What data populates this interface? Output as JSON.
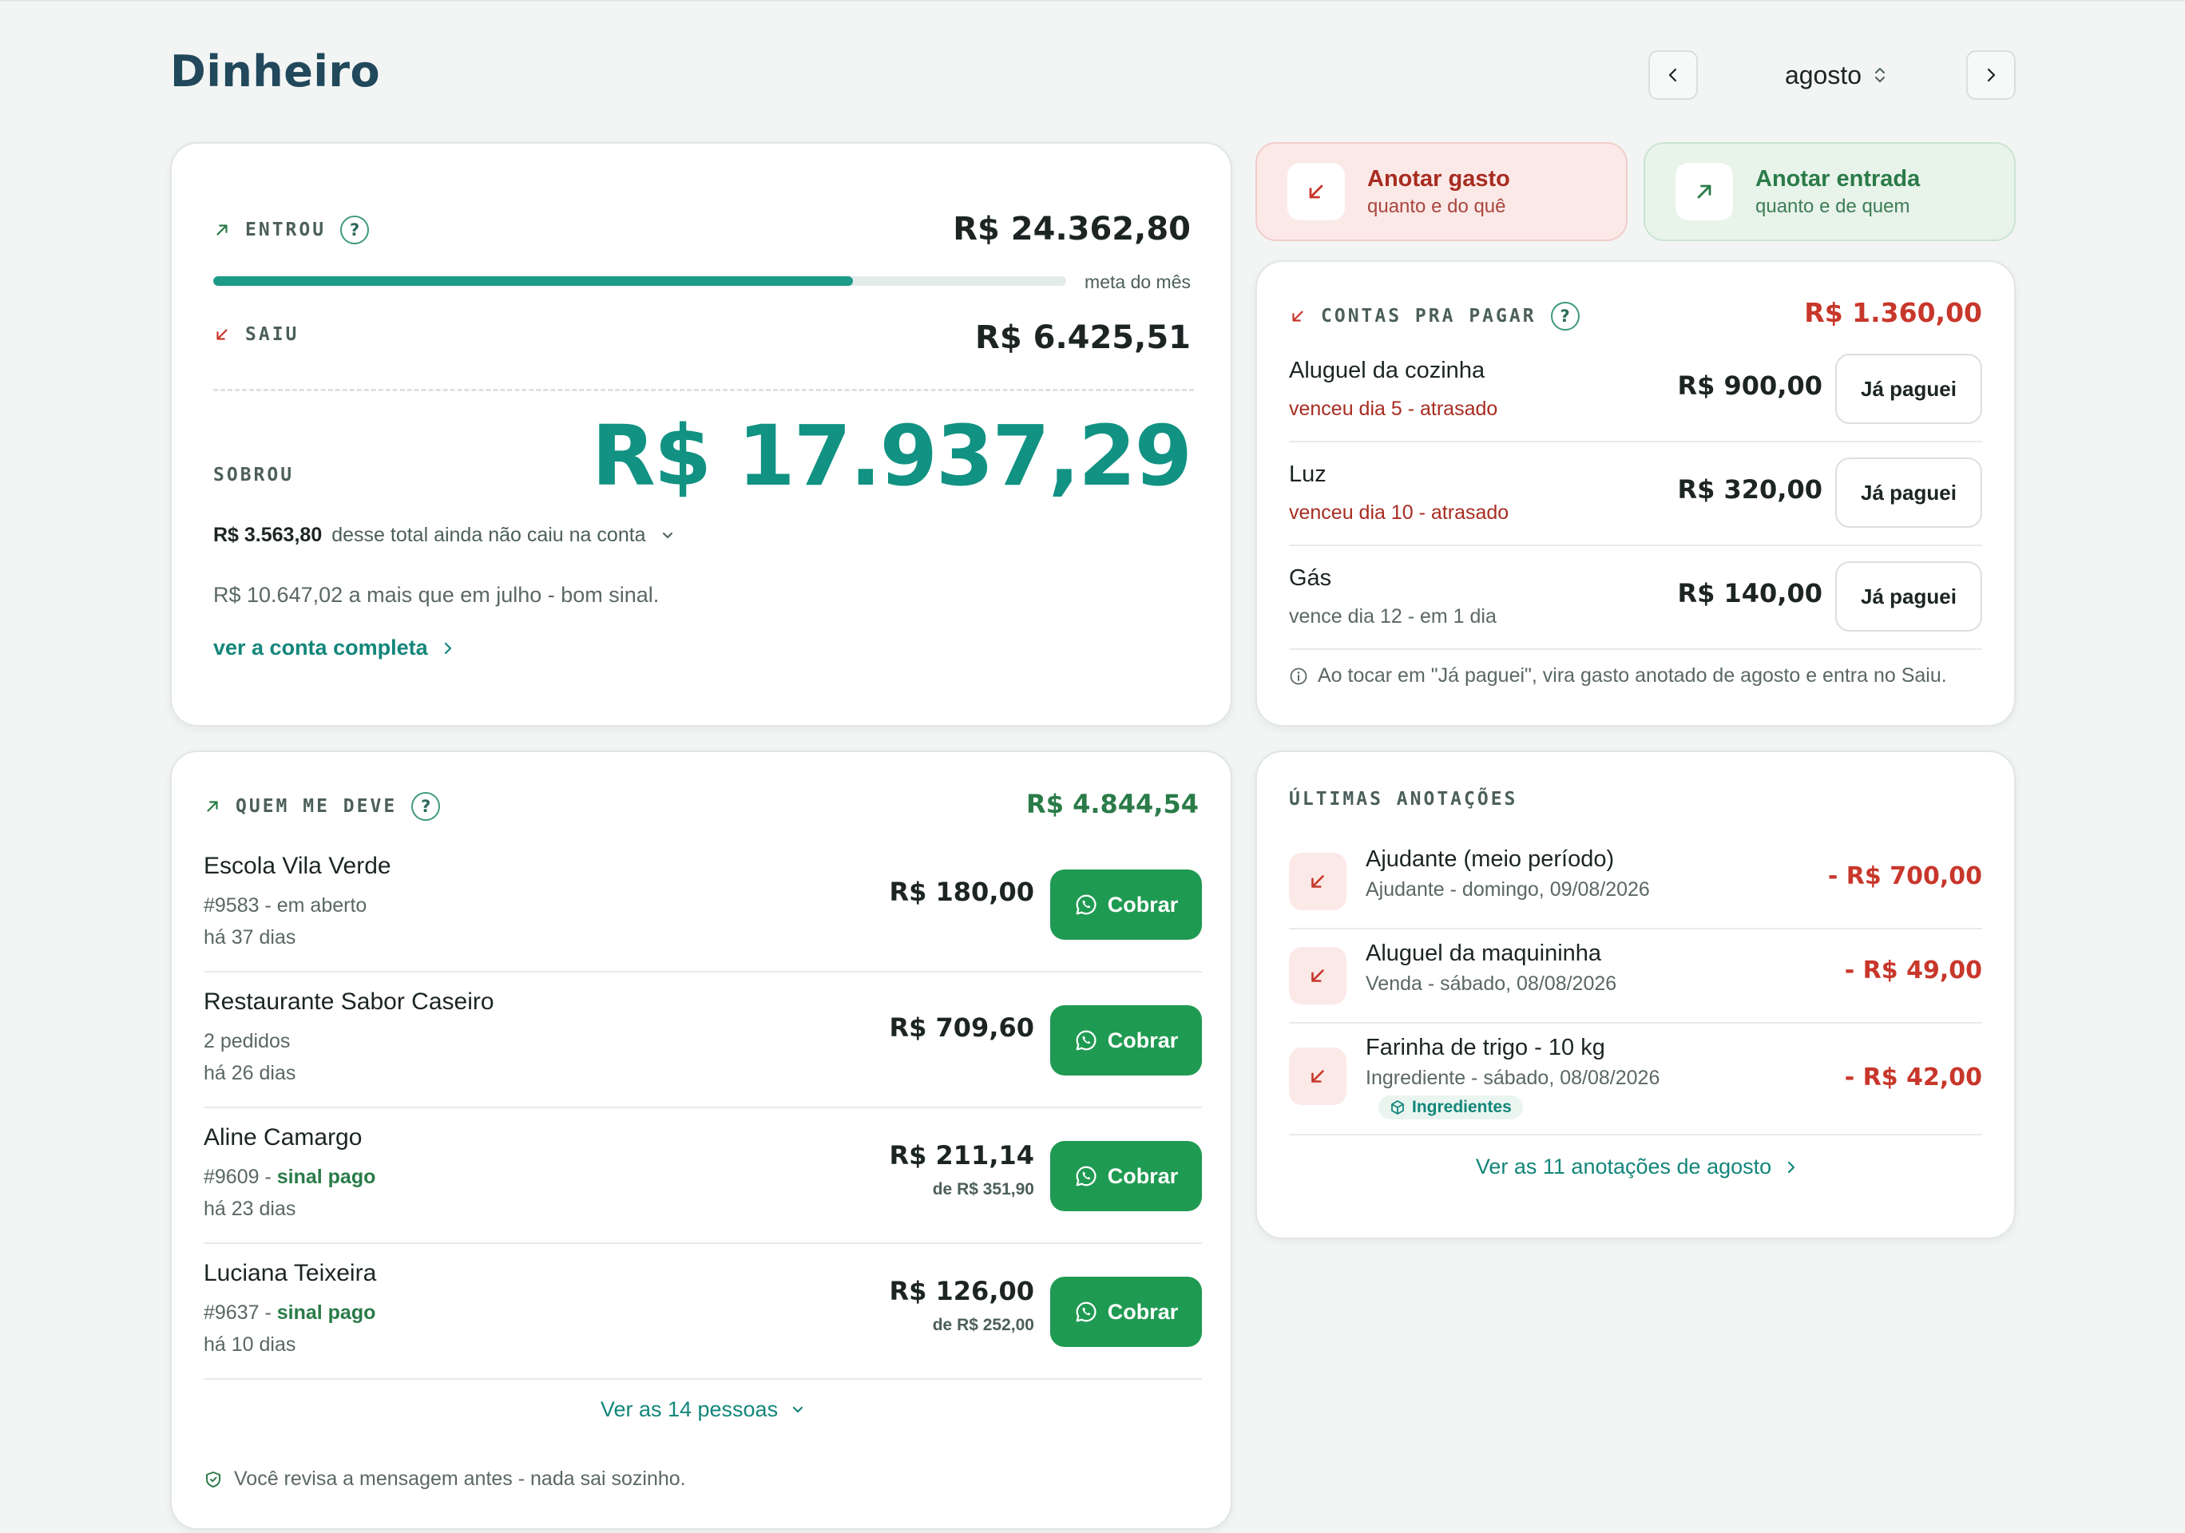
{
  "header": {
    "app_title": "Dinheiro",
    "month": "agosto"
  },
  "resumo": {
    "entrou_label": "ENTROU",
    "entrou_value": "R$ 24.362,80",
    "progress_fraction": 0.75,
    "meta_label": "meta do mês",
    "saiu_label": "SAIU",
    "saiu_value": "R$ 6.425,51",
    "sobrou_label": "SOBROU",
    "sobrou_value": "R$ 17.937,29",
    "pendente_value": "R$ 3.563,80",
    "pendente_text": "desse total ainda não caiu na conta",
    "comparison": "R$ 10.647,02 a mais que em julho - bom sinal.",
    "link": "ver a conta completa"
  },
  "actions": {
    "gasto_title": "Anotar gasto",
    "gasto_sub": "quanto e do quê",
    "entrada_title": "Anotar entrada",
    "entrada_sub": "quanto e de quem"
  },
  "contas": {
    "label": "CONTAS PRA PAGAR",
    "total": "R$ 1.360,00",
    "bills": [
      {
        "name": "Aluguel da cozinha",
        "sub": "venceu dia 5 - atrasado",
        "value": "R$ 900,00",
        "button": "Já paguei"
      },
      {
        "name": "Luz",
        "sub": "venceu dia 10 - atrasado",
        "value": "R$ 320,00",
        "button": "Já paguei"
      },
      {
        "name": "Gás",
        "sub": "vence dia 12 - em 1 dia",
        "value": "R$ 140,00",
        "button": "Já paguei"
      }
    ],
    "note": "Ao tocar em \"Já paguei\", vira gasto anotado de agosto e entra no Saiu."
  },
  "deve": {
    "label": "QUEM ME DEVE",
    "total": "R$ 4.844,54",
    "people": [
      {
        "name": "Escola Vila Verde",
        "sub": "#9583 - em aberto",
        "sub_status": "",
        "days": "há 37 dias",
        "value": "R$ 180,00",
        "of": "",
        "button": "Cobrar"
      },
      {
        "name": "Restaurante Sabor Caseiro",
        "sub": "2 pedidos",
        "sub_status": "",
        "days": "há 26 dias",
        "value": "R$ 709,60",
        "of": "",
        "button": "Cobrar"
      },
      {
        "name": "Aline Camargo",
        "sub": "#9609 - ",
        "sub_status": "sinal pago",
        "days": "há 23 dias",
        "value": "R$ 211,14",
        "of": "de R$ 351,90",
        "button": "Cobrar"
      },
      {
        "name": "Luciana Teixeira",
        "sub": "#9637 - ",
        "sub_status": "sinal pago",
        "days": "há 10 dias",
        "value": "R$ 126,00",
        "of": "de R$ 252,00",
        "button": "Cobrar"
      }
    ],
    "ver_todos": "Ver as 14 pessoas",
    "note": "Você revisa a mensagem antes - nada sai sozinho."
  },
  "ultimas": {
    "label": "ÚLTIMAS ANOTAÇÕES",
    "entries": [
      {
        "name": "Ajudante (meio período)",
        "sub": "Ajudante - domingo, 09/08/2026",
        "value": "- R$ 700,00",
        "tag": ""
      },
      {
        "name": "Aluguel da maquininha",
        "sub": "Venda - sábado, 08/08/2026",
        "value": "- R$ 49,00",
        "tag": ""
      },
      {
        "name": "Farinha de trigo - 10 kg",
        "sub": "Ingrediente - sábado, 08/08/2026",
        "value": "- R$ 42,00",
        "tag": "Ingredientes"
      }
    ],
    "ver_todas": "Ver as 11 anotações de agosto"
  },
  "colors": {
    "accent_teal": "#119283",
    "expense_red": "#c8372b",
    "income_green": "#2a7b48",
    "whatsapp_green": "#1f9a52"
  },
  "icons": [
    "chevron-left-icon",
    "chevron-right-icon",
    "sort-icon",
    "arrow-up-right-icon",
    "arrow-down-left-icon",
    "help-icon",
    "chevron-down-icon",
    "info-icon",
    "whatsapp-icon",
    "shield-icon",
    "box-icon"
  ]
}
